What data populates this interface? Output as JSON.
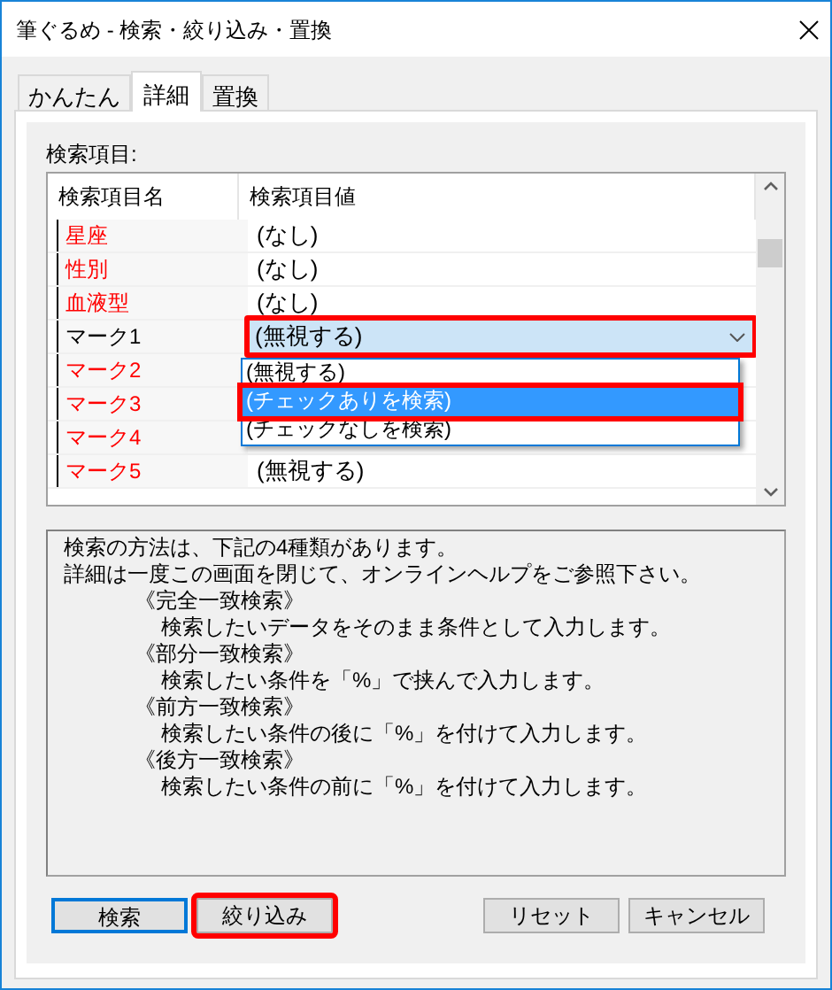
{
  "window": {
    "title": "筆ぐるめ - 検索・絞り込み・置換"
  },
  "tabs": [
    {
      "label": "かんたん",
      "selected": false
    },
    {
      "label": "詳細",
      "selected": true
    },
    {
      "label": "置換",
      "selected": false
    }
  ],
  "section_label": "検索項目:",
  "table": {
    "columns": [
      "検索項目名",
      "検索項目値"
    ],
    "rows": [
      {
        "name": "星座",
        "value": "(なし)",
        "color": "#ff0000"
      },
      {
        "name": "性別",
        "value": "(なし)",
        "color": "#ff0000"
      },
      {
        "name": "血液型",
        "value": "(なし)",
        "color": "#ff0000"
      },
      {
        "name": "マーク1",
        "value": "(無視する)",
        "color": "#000000",
        "editing": true
      },
      {
        "name": "マーク2",
        "color": "#ff0000"
      },
      {
        "name": "マーク3",
        "color": "#ff0000"
      },
      {
        "name": "マーク4",
        "color": "#ff0000"
      },
      {
        "name": "マーク5",
        "value": "(無視する)",
        "color": "#ff0000"
      }
    ]
  },
  "dropdown": {
    "highlighted": true,
    "options": [
      {
        "label": "(無視する)",
        "selected": false,
        "highlighted": false
      },
      {
        "label": "(チェックありを検索)",
        "selected": true,
        "highlighted": true
      },
      {
        "label": "(チェックなしを検索)",
        "selected": false,
        "highlighted": false
      }
    ]
  },
  "description": [
    {
      "text": "検索の方法は、下記の4種類があります。"
    },
    {
      "text": "詳細は一度この画面を閉じて、オンラインヘルプをご参照下さい。",
      "children": [
        {
          "text": "《完全一致検索》",
          "children": [
            {
              "text": "検索したいデータをそのまま条件として入力します。"
            }
          ]
        },
        {
          "text": "《部分一致検索》",
          "children": [
            {
              "text": "検索したい条件を「%」で挟んで入力します。"
            }
          ]
        },
        {
          "text": "《前方一致検索》",
          "children": [
            {
              "text": "検索したい条件の後に「%」を付けて入力します。"
            }
          ]
        },
        {
          "text": "《後方一致検索》",
          "children": [
            {
              "text": "検索したい条件の前に「%」を付けて入力します。"
            }
          ]
        }
      ]
    }
  ],
  "buttons": [
    {
      "label": "検索",
      "default": true,
      "highlighted": false
    },
    {
      "label": "絞り込み",
      "default": false,
      "highlighted": true
    },
    {
      "label": "リセット",
      "default": false,
      "highlighted": false
    },
    {
      "label": "キャンセル",
      "default": false,
      "highlighted": false
    }
  ]
}
